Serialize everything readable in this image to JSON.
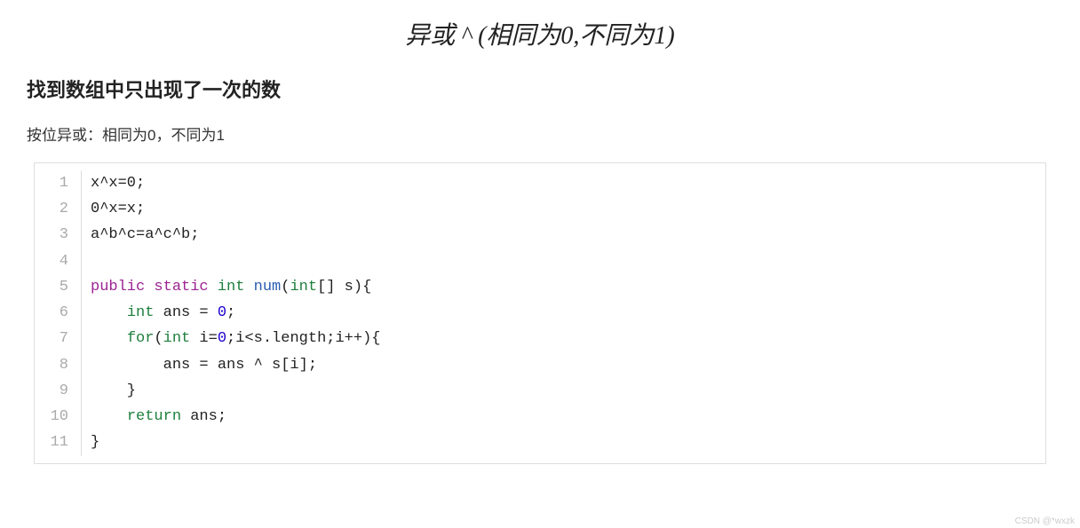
{
  "title": "异或 ^ (相同为0,不同为1)",
  "subtitle": "找到数组中只出现了一次的数",
  "description": "按位异或：相同为0，不同为1",
  "code": {
    "lines": [
      {
        "n": "1",
        "tokens": [
          {
            "cls": "tok-txt",
            "t": "x^x=0;"
          }
        ]
      },
      {
        "n": "2",
        "tokens": [
          {
            "cls": "tok-txt",
            "t": "0^x=x;"
          }
        ]
      },
      {
        "n": "3",
        "tokens": [
          {
            "cls": "tok-txt",
            "t": "a^b^c=a^c^b;"
          }
        ]
      },
      {
        "n": "4",
        "tokens": [
          {
            "cls": "tok-txt",
            "t": ""
          }
        ]
      },
      {
        "n": "5",
        "tokens": [
          {
            "cls": "tok-kw1",
            "t": "public"
          },
          {
            "cls": "tok-txt",
            "t": " "
          },
          {
            "cls": "tok-kw1",
            "t": "static"
          },
          {
            "cls": "tok-txt",
            "t": " "
          },
          {
            "cls": "tok-kw2",
            "t": "int"
          },
          {
            "cls": "tok-txt",
            "t": " "
          },
          {
            "cls": "tok-fn",
            "t": "num"
          },
          {
            "cls": "tok-txt",
            "t": "("
          },
          {
            "cls": "tok-kw2",
            "t": "int"
          },
          {
            "cls": "tok-txt",
            "t": "[] s){"
          }
        ]
      },
      {
        "n": "6",
        "tokens": [
          {
            "cls": "tok-txt",
            "t": "    "
          },
          {
            "cls": "tok-kw2",
            "t": "int"
          },
          {
            "cls": "tok-txt",
            "t": " ans = "
          },
          {
            "cls": "tok-num",
            "t": "0"
          },
          {
            "cls": "tok-txt",
            "t": ";"
          }
        ]
      },
      {
        "n": "7",
        "tokens": [
          {
            "cls": "tok-txt",
            "t": "    "
          },
          {
            "cls": "tok-kw2",
            "t": "for"
          },
          {
            "cls": "tok-txt",
            "t": "("
          },
          {
            "cls": "tok-kw2",
            "t": "int"
          },
          {
            "cls": "tok-txt",
            "t": " i="
          },
          {
            "cls": "tok-num",
            "t": "0"
          },
          {
            "cls": "tok-txt",
            "t": ";i<s.length;i++){"
          }
        ]
      },
      {
        "n": "8",
        "tokens": [
          {
            "cls": "tok-txt",
            "t": "        ans = ans ^ s[i];"
          }
        ]
      },
      {
        "n": "9",
        "tokens": [
          {
            "cls": "tok-txt",
            "t": "    }"
          }
        ]
      },
      {
        "n": "10",
        "tokens": [
          {
            "cls": "tok-txt",
            "t": "    "
          },
          {
            "cls": "tok-kw2",
            "t": "return"
          },
          {
            "cls": "tok-txt",
            "t": " ans;"
          }
        ]
      },
      {
        "n": "11",
        "tokens": [
          {
            "cls": "tok-txt",
            "t": "}"
          }
        ]
      }
    ]
  },
  "watermark": "CSDN @*wxzk"
}
